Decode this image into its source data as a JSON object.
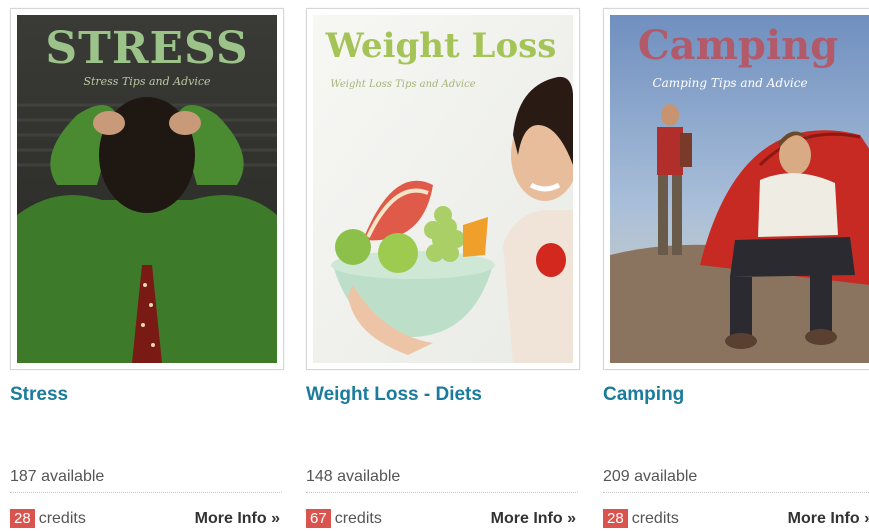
{
  "products": [
    {
      "cover_title": "STRESS",
      "cover_subtitle": "Stress Tips and Advice",
      "title": "Stress",
      "available": "187 available",
      "credits": "28",
      "credits_label": "credits",
      "more": "More Info »"
    },
    {
      "cover_title": "Weight Loss",
      "cover_subtitle": "Weight Loss Tips and Advice",
      "title": "Weight Loss - Diets",
      "available": "148 available",
      "credits": "67",
      "credits_label": "credits",
      "more": "More Info »"
    },
    {
      "cover_title": "Camping",
      "cover_subtitle": "Camping Tips and Advice",
      "title": "Camping",
      "available": "209 available",
      "credits": "28",
      "credits_label": "credits",
      "more": "More Info »"
    }
  ],
  "colors": {
    "title_link": "#1b7b9c",
    "credit_badge": "#d9534f"
  }
}
